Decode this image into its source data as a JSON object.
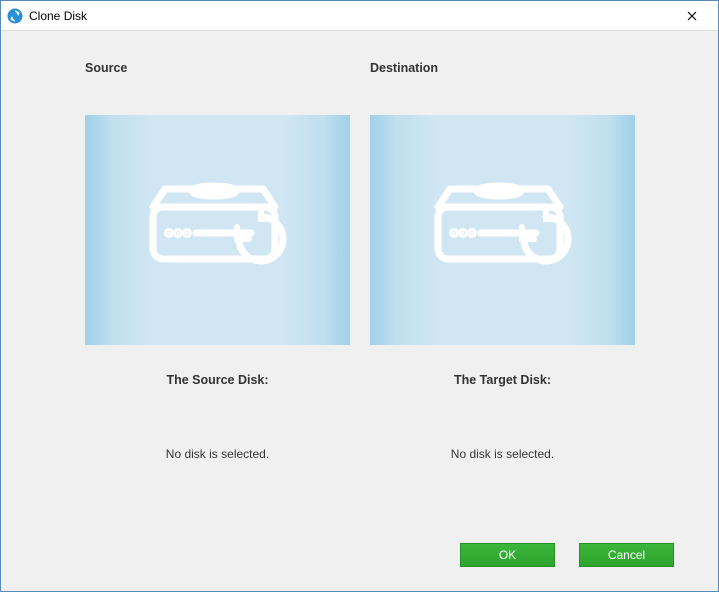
{
  "window": {
    "title": "Clone Disk"
  },
  "source": {
    "header": "Source",
    "label": "The Source Disk:",
    "status": "No disk is selected."
  },
  "destination": {
    "header": "Destination",
    "label": "The Target Disk:",
    "status": "No disk is selected."
  },
  "buttons": {
    "ok": "OK",
    "cancel": "Cancel"
  }
}
